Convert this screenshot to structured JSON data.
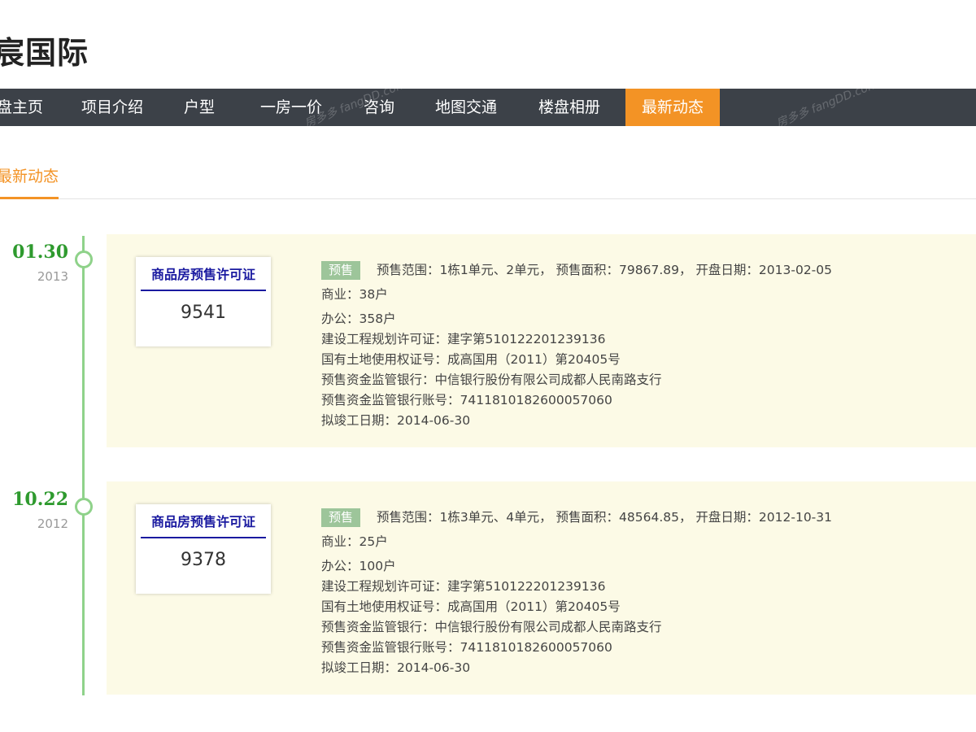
{
  "header": {
    "title": "宸国际"
  },
  "nav": {
    "items": [
      {
        "label": "盘主页"
      },
      {
        "label": "项目介绍"
      },
      {
        "label": "户型"
      },
      {
        "label": "一房一价"
      },
      {
        "label": "咨询"
      },
      {
        "label": "地图交通"
      },
      {
        "label": "楼盘相册"
      },
      {
        "label": "最新动态"
      }
    ],
    "active_index": 7,
    "watermark": "房多多 fangDD.com"
  },
  "subtab": {
    "label": "最新动态"
  },
  "colors": {
    "accent": "#f39325",
    "nav_bg": "#3c4148",
    "timeline": "#8fd28a",
    "date": "#2e9a2e",
    "card_bg": "#fcfae6",
    "permit_title": "#1a1aa0",
    "badge": "#9dc59a"
  },
  "entries": [
    {
      "date": "01.30",
      "year": "2013",
      "permit_title": "商品房预售许可证",
      "permit_number": "9541",
      "badge": "预售",
      "summary": "预售范围：1栋1单元、2单元，  预售面积：79867.89，  开盘日期：2013-02-05",
      "commercial": "商业：38户",
      "office": "办公：358户",
      "planning_permit": "建设工程规划许可证：建字第510122201239136",
      "land_cert": "国有土地使用权证号：成高国用（2011）第20405号",
      "bank": "预售资金监管银行：中信银行股份有限公司成都人民南路支行",
      "account": "预售资金监管银行账号：7411810182600057060",
      "completion": "拟竣工日期：2014-06-30"
    },
    {
      "date": "10.22",
      "year": "2012",
      "permit_title": "商品房预售许可证",
      "permit_number": "9378",
      "badge": "预售",
      "summary": "预售范围：1栋3单元、4单元，  预售面积：48564.85，  开盘日期：2012-10-31",
      "commercial": "商业：25户",
      "office": "办公：100户",
      "planning_permit": "建设工程规划许可证：建字第510122201239136",
      "land_cert": "国有土地使用权证号：成高国用（2011）第20405号",
      "bank": "预售资金监管银行：中信银行股份有限公司成都人民南路支行",
      "account": "预售资金监管银行账号：7411810182600057060",
      "completion": "拟竣工日期：2014-06-30"
    }
  ]
}
